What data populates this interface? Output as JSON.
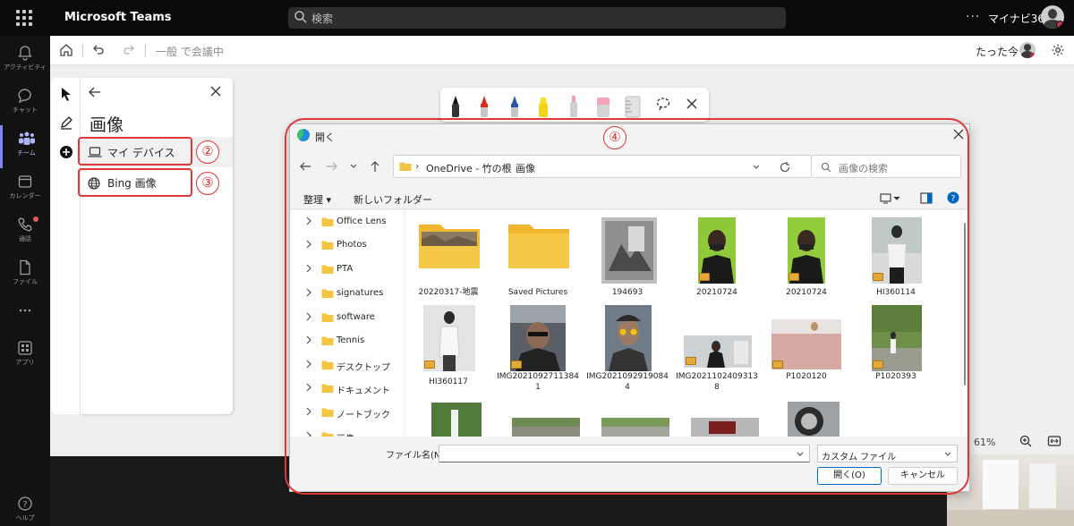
{
  "app": {
    "title": "Microsoft Teams",
    "search_placeholder": "検索",
    "more": "···",
    "org_name": "マイナビ365"
  },
  "rail": [
    {
      "label": "アクティビティ",
      "icon": "bell-icon"
    },
    {
      "label": "チャット",
      "icon": "chat-icon"
    },
    {
      "label": "チーム",
      "icon": "teams-icon",
      "active": true
    },
    {
      "label": "カレンダー",
      "icon": "calendar-icon"
    },
    {
      "label": "通話",
      "icon": "phone-icon"
    },
    {
      "label": "ファイル",
      "icon": "file-icon"
    },
    {
      "label": "···",
      "icon": "more-icon"
    },
    {
      "label": "アプリ",
      "icon": "apps-icon"
    },
    {
      "label": "ヘルプ",
      "icon": "help-icon"
    }
  ],
  "meeting_bar": {
    "title": "一般 で会議中",
    "recent": "たった今"
  },
  "zoom": {
    "value": "61%"
  },
  "image_panel": {
    "title": "画像",
    "options": [
      {
        "label": "マイ デバイス",
        "number": "②"
      },
      {
        "label": "Bing 画像",
        "number": "③"
      }
    ]
  },
  "annotation": {
    "number": "④"
  },
  "dialog": {
    "title": "開く",
    "path": [
      "OneDrive - 竹の根",
      "画像"
    ],
    "search_placeholder": "画像の検索",
    "commands": {
      "organize": "整理 ▾",
      "new_folder": "新しいフォルダー"
    },
    "tree": [
      "Office Lens",
      "Photos",
      "PTA",
      "signatures",
      "software",
      "Tennis",
      "デスクトップ",
      "ドキュメント",
      "ノートブック",
      "画像"
    ],
    "files": [
      {
        "name": "20220317-地震"
      },
      {
        "name": "Saved Pictures"
      },
      {
        "name": "194693"
      },
      {
        "name": "20210724"
      },
      {
        "name": "20210724"
      },
      {
        "name": "HI360114"
      },
      {
        "name": "HI360117"
      },
      {
        "name": "IMG20210927113841"
      },
      {
        "name": "IMG20210929190844"
      },
      {
        "name": "IMG20211024093138"
      },
      {
        "name": "P1020120"
      },
      {
        "name": "P1020393"
      }
    ],
    "filename_label": "ファイル名(N):",
    "filename_value": "",
    "filetype_value": "カスタム ファイル",
    "open_button": "開く(O)",
    "cancel_button": "キャンセル"
  },
  "colors": {
    "accent_red": "#e03838",
    "teams_purple": "#7f85f5",
    "folder_yellow": "#f4c542",
    "dialog_blue": "#0067c0"
  }
}
